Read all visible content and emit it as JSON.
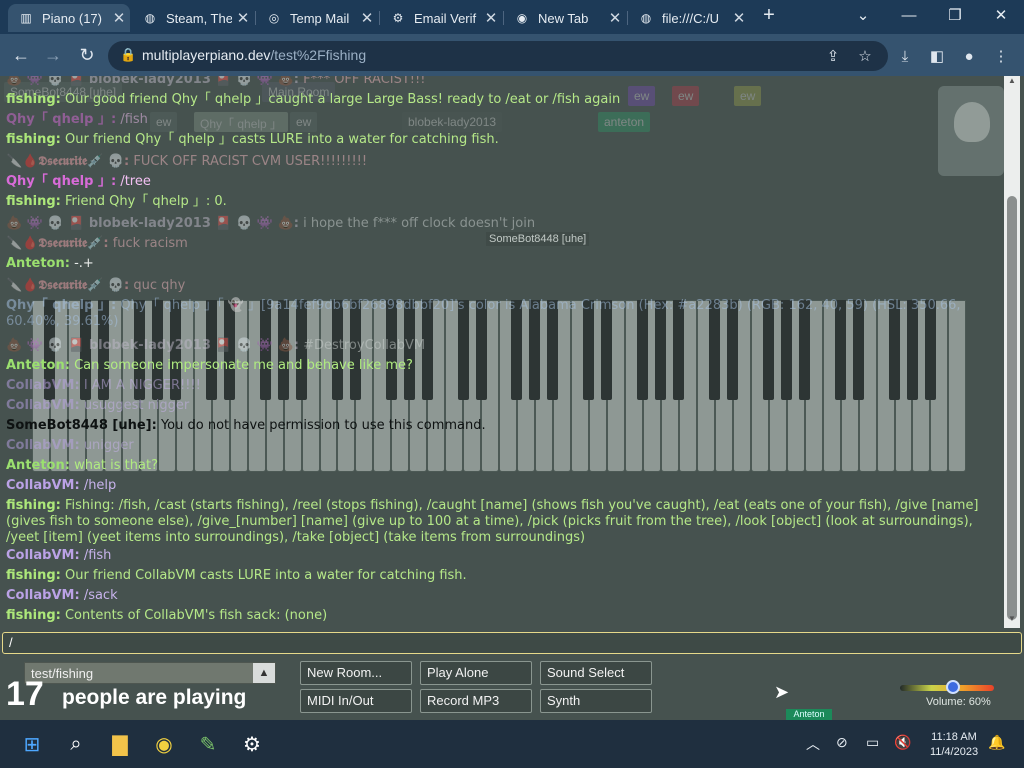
{
  "browser": {
    "tabs": [
      {
        "label": "Piano (17)",
        "icon": "piano-icon",
        "active": true
      },
      {
        "label": "Steam, The",
        "icon": "globe-icon"
      },
      {
        "label": "Temp Mail",
        "icon": "tempmail-icon"
      },
      {
        "label": "Email Verif",
        "icon": "steam-icon"
      },
      {
        "label": "New Tab",
        "icon": "chrome-icon"
      },
      {
        "label": "file:///C:/U",
        "icon": "globe-icon"
      }
    ],
    "close_glyph": "✕",
    "new_tab_glyph": "+",
    "url_host": "multiplayerpiano.dev",
    "url_path": "/test%2Ffishing"
  },
  "ghost": {
    "chips": [
      "SomeBot8448 [uhe]",
      "Main Room",
      "ew",
      "ew",
      "ew",
      "Qhy「 qhelp 」",
      "ew",
      "blobek-lady2013",
      "anteton",
      "ew"
    ],
    "cursor_tag": "SomeBot8448 [uhe]"
  },
  "chat": [
    {
      "name": "💩 👾 💀 🎴  blobek-lady2013  🎴 💀 👾 💩:",
      "text": "F*** OFF RACIST!!!",
      "nc": "blob",
      "tc": "txt-pink"
    },
    {
      "name": "fishing:",
      "text": "Our good friend Qhy「 qhelp 」caught a large Large Bass! ready to /eat or /fish again",
      "nc": "bot",
      "tc": "txt-bot"
    },
    {
      "name": "Qhy「 qhelp 」:",
      "text": "/fish",
      "nc": "qhy",
      "tc": "txt-qhy"
    },
    {
      "name": "fishing:",
      "text": "Our friend Qhy「 qhelp 」casts LURE into a water for catching fish.",
      "nc": "bot",
      "tc": "txt-bot"
    },
    {
      "name": "🔪🩸𝕯𝖘𝖊𝖈𝖚𝖗𝖎𝖙𝖊💉 💀:",
      "text": "FUCK OFF RACIST CVM USER!!!!!!!!!",
      "nc": "dsec",
      "tc": "txt-pink"
    },
    {
      "name": "Qhy「 qhelp 」:",
      "text": "/tree",
      "nc": "qhy",
      "tc": "txt-qhy"
    },
    {
      "name": "fishing:",
      "text": "Friend Qhy「 qhelp 」: 0.",
      "nc": "bot",
      "tc": "txt-bot"
    },
    {
      "name": "💩 👾 💀 🎴  blobek-lady2013  🎴 💀 👾 💩:",
      "text": "i hope the f*** off clock doesn't join",
      "nc": "blob",
      "tc": "txt-blob"
    },
    {
      "name": "🔪🩸𝕯𝖘𝖊𝖈𝖚𝖗𝖎𝖙𝖊💉:",
      "text": "fuck racism",
      "nc": "dsec",
      "tc": "txt-pink"
    },
    {
      "name": "Anteton:",
      "text": "-.+",
      "nc": "ant",
      "tc": "txt-light"
    },
    {
      "name": "🔪🩸𝕯𝖘𝖊𝖈𝖚𝖗𝖎𝖙𝖊💉 💀:",
      "text": "quc qhy",
      "nc": "dsec",
      "tc": "txt-pink"
    },
    {
      "name": "Qhy「 qhelp 」:",
      "text": "Qhy「 qhelp 」「 👻 」[9a14fef9db6bf26898dbbf20]'s color is Alabama Crimson (Hex: #a2283b) (RGB: 162, 40, 59) (HSL: 350.66, 60.40%, 39.61%)",
      "nc": "qhyb",
      "tc": "qhyb"
    },
    {
      "name": "💩 👾 💀 🎴  blobek-lady2013  🎴 💀 👾 💩:",
      "text": "#DestroyCollabVM",
      "nc": "blob",
      "tc": "txt-blob"
    },
    {
      "name": "Anteton:",
      "text": "Can someone impersonate me and behave like me?",
      "nc": "ant",
      "tc": "txt-ant"
    },
    {
      "name": "CollabVM:",
      "text": "I AM A NIGGER!!!!",
      "nc": "cvm",
      "tc": "txt-cvm"
    },
    {
      "name": "CollabVM:",
      "text": "usuggest nigger",
      "nc": "cvm",
      "tc": "txt-cvm"
    },
    {
      "name": "SomeBot8448 [uhe]:",
      "text": "You do not have permission to use this command.",
      "nc": "some",
      "tc": "somet"
    },
    {
      "name": "CollabVM:",
      "text": "unigger",
      "nc": "cvm",
      "tc": "txt-cvm"
    },
    {
      "name": "Anteton:",
      "text": "what is that?",
      "nc": "ant",
      "tc": "txt-ant"
    },
    {
      "name": "CollabVM:",
      "text": "/help",
      "nc": "cvm",
      "tc": "txt-cvm"
    },
    {
      "name": "fishing:",
      "text": "Fishing: /fish, /cast (starts fishing), /reel (stops fishing), /caught [name] (shows fish you've caught), /eat (eats one of your fish), /give [name] (gives fish to someone else), /give_[number] [name] (give up to 100 at a time), /pick (picks fruit from the tree), /look [object] (look at surroundings), /yeet [item] (yeet items into surroundings), /take [object] (take items from surroundings)",
      "nc": "bot",
      "tc": "txt-bot"
    },
    {
      "name": "CollabVM:",
      "text": "/fish",
      "nc": "cvm",
      "tc": "txt-cvm"
    },
    {
      "name": "fishing:",
      "text": "Our friend CollabVM casts LURE into a water for catching fish.",
      "nc": "bot",
      "tc": "txt-bot"
    },
    {
      "name": "CollabVM:",
      "text": "/sack",
      "nc": "cvm",
      "tc": "txt-cvm"
    },
    {
      "name": "fishing:",
      "text": "Contents of CollabVM's fish sack: (none)",
      "nc": "bot",
      "tc": "txt-bot"
    }
  ],
  "chat_input": {
    "value": "/"
  },
  "room": {
    "name": "test/fishing",
    "arrow": "▲"
  },
  "players": {
    "count": "17",
    "label": "people are playing"
  },
  "buttons": {
    "new_room": "New Room...",
    "play_alone": "Play Alone",
    "sound_select": "Sound Select",
    "midi": "MIDI In/Out",
    "record": "Record MP3",
    "synth": "Synth"
  },
  "volume": {
    "label": "Volume: 60%",
    "level": 0.6
  },
  "anteton_badge": "Anteton",
  "taskbar": {
    "apps": [
      {
        "icon": "windows-start-icon",
        "glyph": "⊞"
      },
      {
        "icon": "search-icon",
        "glyph": "⌕"
      },
      {
        "icon": "file-explorer-icon",
        "glyph": "▇"
      },
      {
        "icon": "chrome-icon",
        "glyph": "◉"
      },
      {
        "icon": "notepad-icon",
        "glyph": "✎"
      },
      {
        "icon": "steam-icon",
        "glyph": "⚙"
      }
    ],
    "time": "11:18 AM",
    "date": "11/4/2023"
  }
}
